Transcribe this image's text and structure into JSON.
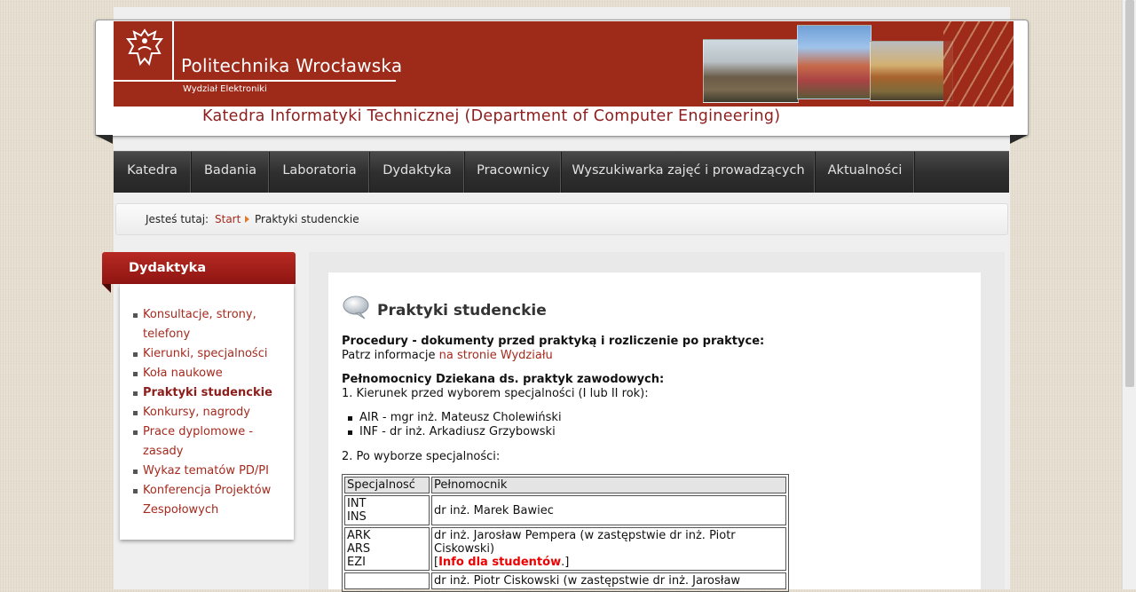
{
  "header": {
    "brand": "Politechnika Wrocławska",
    "faculty": "Wydział Elektroniki",
    "subtitle": "Katedra Informatyki Technicznej (Department of Computer Engineering)",
    "logo_icon": "eagle-icon"
  },
  "nav": {
    "items": [
      {
        "label": "Katedra"
      },
      {
        "label": "Badania"
      },
      {
        "label": "Laboratoria"
      },
      {
        "label": "Dydaktyka"
      },
      {
        "label": "Pracownicy"
      },
      {
        "label": "Wyszukiwarka zajęć i prowadzących"
      },
      {
        "label": "Aktualności"
      }
    ]
  },
  "breadcrumb": {
    "prefix": "Jesteś tutaj:",
    "start": "Start",
    "current": "Praktyki studenckie"
  },
  "sidebar": {
    "title": "Dydaktyka",
    "items": [
      {
        "label": "Konsultacje, strony, telefony"
      },
      {
        "label": "Kierunki, specjalności"
      },
      {
        "label": "Koła naukowe"
      },
      {
        "label": "Praktyki studenckie",
        "active": true
      },
      {
        "label": "Konkursy, nagrody"
      },
      {
        "label": "Prace dyplomowe - zasady"
      },
      {
        "label": "Wykaz tematów PD/PI"
      },
      {
        "label": "Konferencja Projektów Zespołowych"
      }
    ]
  },
  "content": {
    "title": "Praktyki studenckie",
    "procedures_heading": "Procedury - dokumenty przed praktyką i rozliczenie po praktyce:",
    "procedures_text": "Patrz informacje ",
    "procedures_link": "na stronie Wydziału",
    "plenipotentiaries_heading": "Pełnomocnicy Dziekana ds. praktyk zawodowych:",
    "point1": "1. Kierunek przed wyborem specjalności (I lub II rok):",
    "bullets": [
      "AIR - mgr inż. Mateusz Cholewiński",
      "INF - dr inż. Arkadiusz Grzybowski"
    ],
    "point2": "2. Po wyborze specjalności:",
    "table": {
      "headers": [
        "Specjalnosć",
        "Pełnomocnik"
      ],
      "rows": [
        {
          "spec": [
            "INT",
            "INS"
          ],
          "person": "dr inż. Marek Bawiec"
        },
        {
          "spec": [
            "ARK",
            "ARS",
            "EZI"
          ],
          "person": "dr inż. Jarosław Pempera (w zastępstwie dr inż. Piotr Ciskowski)",
          "info_open": "[",
          "info_link": "Info dla studentów",
          "info_close": ".]"
        },
        {
          "spec": [
            ""
          ],
          "person": "dr inż. Piotr Ciskowski (w zastępstwie dr inż. Jarosław"
        }
      ]
    }
  },
  "colors": {
    "brand_red": "#9e2a1a",
    "link": "#a52a1e",
    "nav_bg": "#2f2f2f",
    "alert_link": "#ee0000"
  }
}
